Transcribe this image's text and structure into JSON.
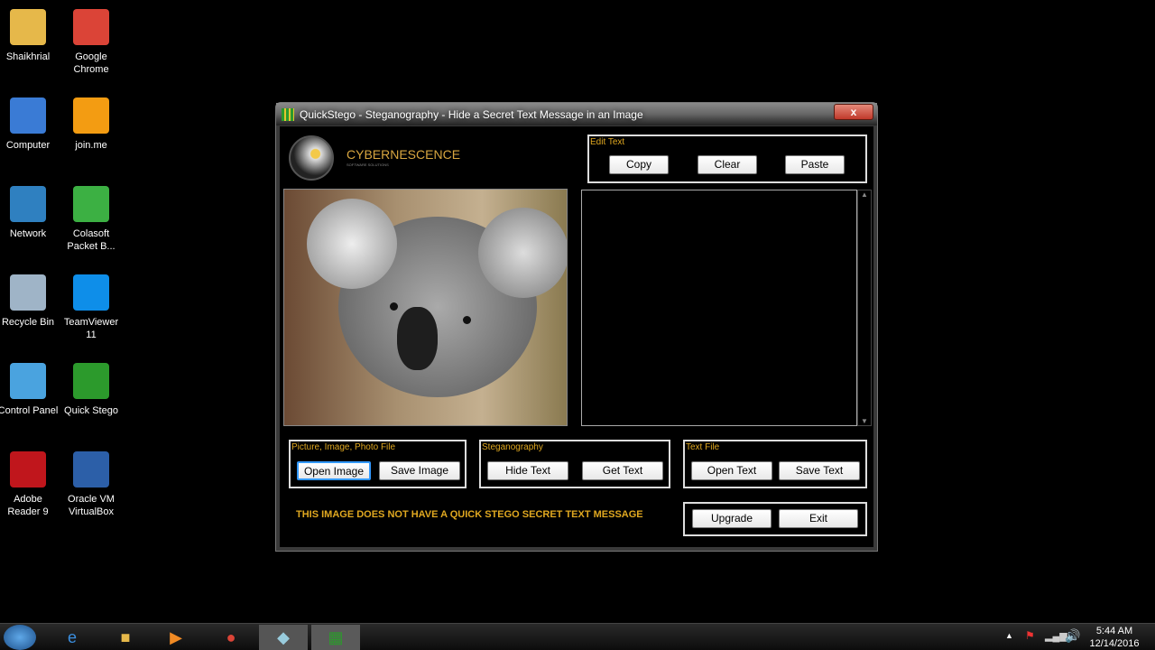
{
  "desktop": {
    "icons": [
      {
        "label": "Shaikhrial",
        "icon": "folder-user-icon",
        "color": "#e6b84a"
      },
      {
        "label": "Google Chrome",
        "icon": "chrome-icon",
        "color": "#db4437"
      },
      {
        "label": "Computer",
        "icon": "computer-icon",
        "color": "#3a7bd5"
      },
      {
        "label": "join.me",
        "icon": "joinme-icon",
        "color": "#f39c12"
      },
      {
        "label": "Network",
        "icon": "network-icon",
        "color": "#2f80c0"
      },
      {
        "label": "Colasoft Packet B...",
        "icon": "colasoft-icon",
        "color": "#3cb043"
      },
      {
        "label": "Recycle Bin",
        "icon": "recycle-bin-icon",
        "color": "#9fb4c7"
      },
      {
        "label": "TeamViewer 11",
        "icon": "teamviewer-icon",
        "color": "#0e8ee9"
      },
      {
        "label": "Control Panel",
        "icon": "control-panel-icon",
        "color": "#4aa3df"
      },
      {
        "label": "Quick Stego",
        "icon": "quick-stego-icon",
        "color": "#2c9a2c"
      },
      {
        "label": "Adobe Reader 9",
        "icon": "adobe-reader-icon",
        "color": "#c0161c"
      },
      {
        "label": "Oracle VM VirtualBox",
        "icon": "virtualbox-icon",
        "color": "#2c5fa8"
      }
    ]
  },
  "window": {
    "title": "QuickStego - Steganography - Hide a Secret Text Message in an Image",
    "close": "x",
    "logo": {
      "name": "CYBERNESCENCE",
      "tagline": "SOFTWARE SOLUTIONS"
    },
    "edit_text": {
      "label": "Edit Text",
      "copy": "Copy",
      "clear": "Clear",
      "paste": "Paste"
    },
    "picture": {
      "label": "Picture, Image, Photo File",
      "open": "Open Image",
      "save": "Save Image"
    },
    "stego": {
      "label": "Steganography",
      "hide": "Hide Text",
      "get": "Get Text"
    },
    "textfile": {
      "label": "Text File",
      "open": "Open Text",
      "save": "Save Text"
    },
    "status": "THIS IMAGE DOES NOT HAVE A QUICK STEGO SECRET TEXT MESSAGE",
    "upgrade": "Upgrade",
    "exit": "Exit",
    "text_area": ""
  },
  "tray": {
    "time": "5:44 AM",
    "date": "12/14/2016"
  },
  "colors": {
    "accent": "#e0a820"
  }
}
